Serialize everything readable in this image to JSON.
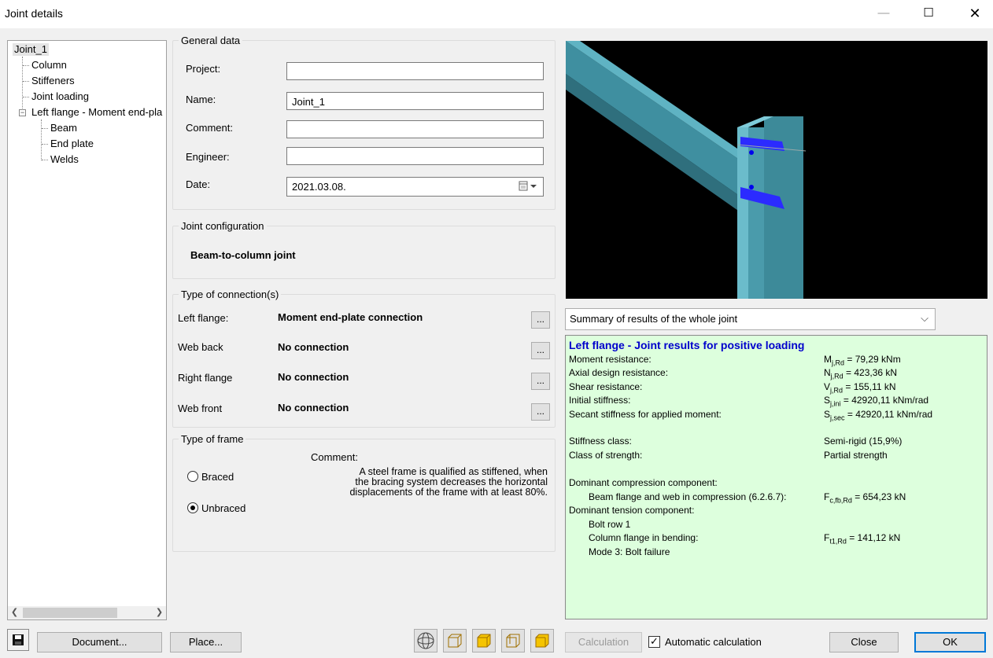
{
  "window": {
    "title": "Joint details",
    "min": "—",
    "max": "☐",
    "close": "✕"
  },
  "tree": {
    "root": "Joint_1",
    "items": [
      "Column",
      "Stiffeners",
      "Joint loading"
    ],
    "branch": "Left flange - Moment end-pla",
    "children": [
      "Beam",
      "End plate",
      "Welds"
    ],
    "collapse_glyph": "−"
  },
  "general": {
    "title": "General data",
    "project_label": "Project:",
    "project_value": "",
    "name_label": "Name:",
    "name_value": "Joint_1",
    "comment_label": "Comment:",
    "comment_value": "",
    "engineer_label": "Engineer:",
    "engineer_value": "",
    "date_label": "Date:",
    "date_value": "2021.03.08."
  },
  "config": {
    "title": "Joint configuration",
    "value": "Beam-to-column joint"
  },
  "connections": {
    "title": "Type of connection(s)",
    "more": "...",
    "rows": [
      {
        "label": "Left flange:",
        "value": "Moment end-plate connection"
      },
      {
        "label": "Web back",
        "value": "No connection"
      },
      {
        "label": "Right flange",
        "value": "No connection"
      },
      {
        "label": "Web front",
        "value": "No connection"
      }
    ]
  },
  "frame": {
    "title": "Type of frame",
    "braced": "Braced",
    "unbraced": "Unbraced",
    "selected": "unbraced",
    "comment_label": "Comment:",
    "comment_lines": [
      "A steel frame is qualified as stiffened, when",
      "the bracing system decreases the horizontal",
      "displacements of the frame with at least 80%."
    ]
  },
  "results_select": {
    "value": "Summary of results of the whole joint"
  },
  "results": {
    "title": "Left flange - Joint results for positive loading",
    "rows": [
      {
        "label": "Moment resistance:",
        "sym": "M",
        "sub": "j,Rd",
        "val": " = 79,29 kNm"
      },
      {
        "label": "Axial design resistance:",
        "sym": "N",
        "sub": "j,Rd",
        "val": " = 423,36 kN"
      },
      {
        "label": "Shear resistance:",
        "sym": "V",
        "sub": "j,Rd",
        "val": " = 155,11 kN"
      },
      {
        "label": "Initial stiffness:",
        "sym": "S",
        "sub": "j,ini",
        "val": " = 42920,11 kNm/rad"
      },
      {
        "label": "Secant stiffness for applied moment:",
        "sym": "S",
        "sub": "j,sec",
        "val": " = 42920,11 kNm/rad"
      }
    ],
    "stiffness_class_label": "Stiffness class:",
    "stiffness_class_value": "Semi-rigid (15,9%)",
    "strength_class_label": "Class of strength:",
    "strength_class_value": "Partial strength",
    "dom_comp_label": "Dominant compression component:",
    "dom_comp_item": "Beam flange and web in compression (6.2.6.7):",
    "dom_comp_sym": "F",
    "dom_comp_sub": "c,fb,Rd",
    "dom_comp_val": " = 654,23 kN",
    "dom_tens_label": "Dominant tension component:",
    "dom_tens_row": "Bolt row 1",
    "dom_tens_item": "Column flange in bending:",
    "dom_tens_sym": "F",
    "dom_tens_sub": "t1,Rd",
    "dom_tens_val": " = 141,12 kN",
    "dom_tens_mode": "Mode 3: Bolt failure"
  },
  "bottom": {
    "document": "Document...",
    "place": "Place...",
    "calculation": "Calculation",
    "auto_calc": "Automatic calculation",
    "auto_checked": "✓",
    "close": "Close",
    "ok": "OK"
  },
  "colors": {
    "beam_teal": "#4a9bab",
    "plate_blue": "#2b2bff",
    "results_bg": "#ddffdd",
    "results_title": "#0000cc"
  }
}
